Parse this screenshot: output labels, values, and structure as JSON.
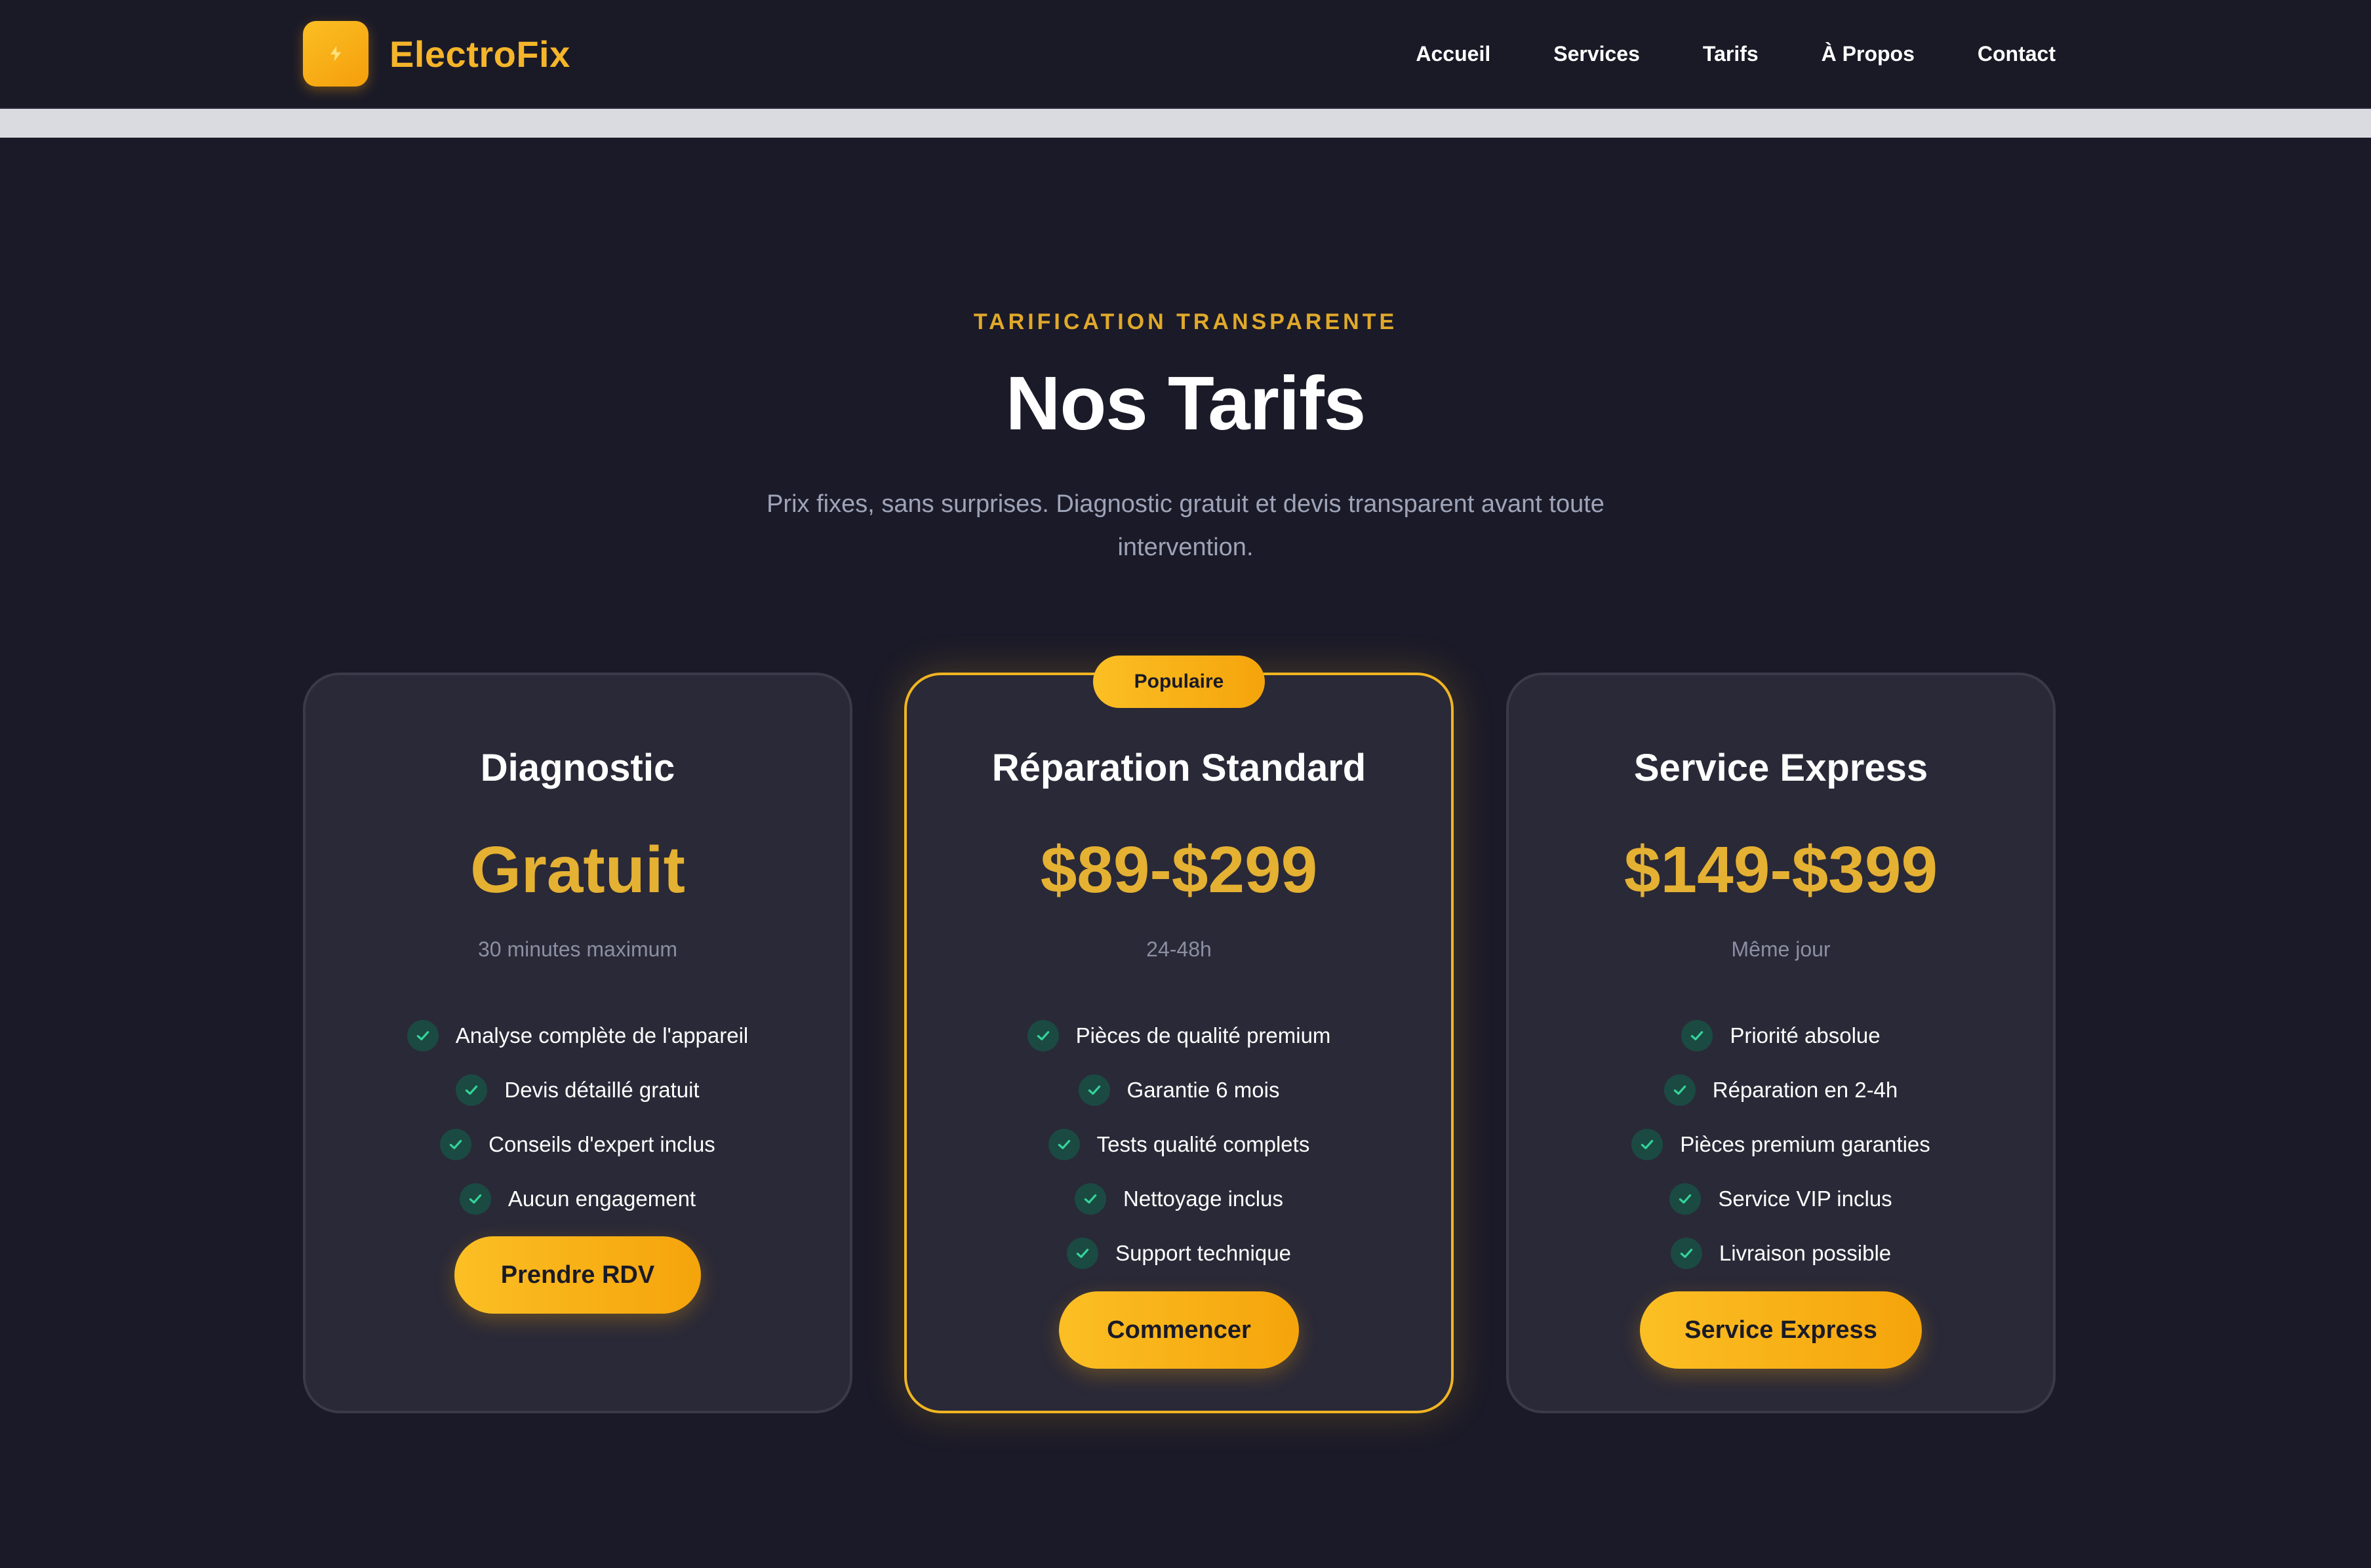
{
  "brand": {
    "name": "ElectroFix",
    "icon": "lightning-icon",
    "color": "#f5b52a"
  },
  "nav": {
    "items": [
      {
        "label": "Accueil"
      },
      {
        "label": "Services"
      },
      {
        "label": "Tarifs"
      },
      {
        "label": "À Propos"
      },
      {
        "label": "Contact"
      }
    ]
  },
  "header": {
    "eyebrow": "TARIFICATION TRANSPARENTE",
    "title": "Nos Tarifs",
    "subtitle": "Prix fixes, sans surprises. Diagnostic gratuit et devis transparent avant toute intervention."
  },
  "colors": {
    "background": "#1b1a28",
    "card": "#2a2937",
    "accent": "#f0b523",
    "price": "#e5b133",
    "check_bg": "#1b4a42",
    "check": "#34d399"
  },
  "plans": [
    {
      "title": "Diagnostic",
      "price": "Gratuit",
      "duration": "30 minutes maximum",
      "features": [
        "Analyse complète de l'appareil",
        "Devis détaillé gratuit",
        "Conseils d'expert inclus",
        "Aucun engagement"
      ],
      "cta": "Prendre RDV"
    },
    {
      "title": "Réparation Standard",
      "badge": "Populaire",
      "price": "$89-$299",
      "duration": "24-48h",
      "features": [
        "Pièces de qualité premium",
        "Garantie 6 mois",
        "Tests qualité complets",
        "Nettoyage inclus",
        "Support technique"
      ],
      "cta": "Commencer"
    },
    {
      "title": "Service Express",
      "price": "$149-$399",
      "duration": "Même jour",
      "features": [
        "Priorité absolue",
        "Réparation en 2-4h",
        "Pièces premium garanties",
        "Service VIP inclus",
        "Livraison possible"
      ],
      "cta": "Service Express"
    }
  ]
}
